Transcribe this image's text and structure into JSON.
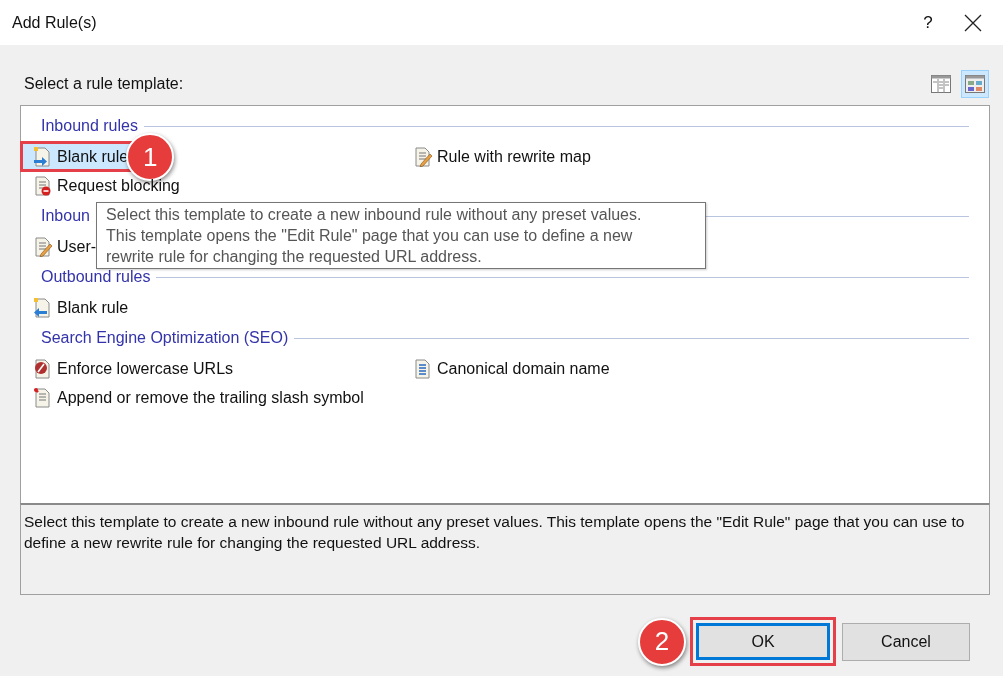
{
  "window": {
    "title": "Add Rule(s)",
    "help": "?"
  },
  "template_label": "Select a rule template:",
  "view_buttons": [
    {
      "kind": "details",
      "selected": false
    },
    {
      "kind": "tiles",
      "selected": true
    }
  ],
  "groups": [
    {
      "title": "Inbound rules",
      "items": [
        {
          "label": "Blank rule",
          "kind": "blank-in",
          "selected": true,
          "highlighted": true,
          "callout": "1"
        },
        {
          "label": "Rule with rewrite map",
          "kind": "edit",
          "selected": false
        },
        {
          "label": "Request blocking",
          "kind": "block",
          "selected": false
        }
      ]
    },
    {
      "title": "Inboun",
      "items": [
        {
          "label": "User-",
          "kind": "edit",
          "selected": false
        }
      ]
    },
    {
      "title": "Outbound rules",
      "items": [
        {
          "label": "Blank rule",
          "kind": "blank-out",
          "selected": false
        }
      ]
    },
    {
      "title": "Search Engine Optimization (SEO)",
      "items": [
        {
          "label": "Enforce lowercase URLs",
          "kind": "lower",
          "selected": false
        },
        {
          "label": "Canonical domain name",
          "kind": "list",
          "selected": false
        },
        {
          "label": "Append or remove the trailing slash symbol",
          "kind": "pin",
          "selected": false
        }
      ]
    }
  ],
  "tooltip": "Select this template to create a new inbound rule without any preset values.\nThis template opens the \"Edit Rule\" page that you can use to define a new\nrewrite rule for changing the requested URL address.",
  "description": "Select this template to create a new inbound rule without any preset values. This template opens the \"Edit Rule\" page that you can use to define a new rewrite rule for changing the requested URL address.",
  "buttons": [
    {
      "label": "OK",
      "default": true,
      "highlighted": true,
      "callout": "2"
    },
    {
      "label": "Cancel",
      "default": false,
      "highlighted": false
    }
  ]
}
